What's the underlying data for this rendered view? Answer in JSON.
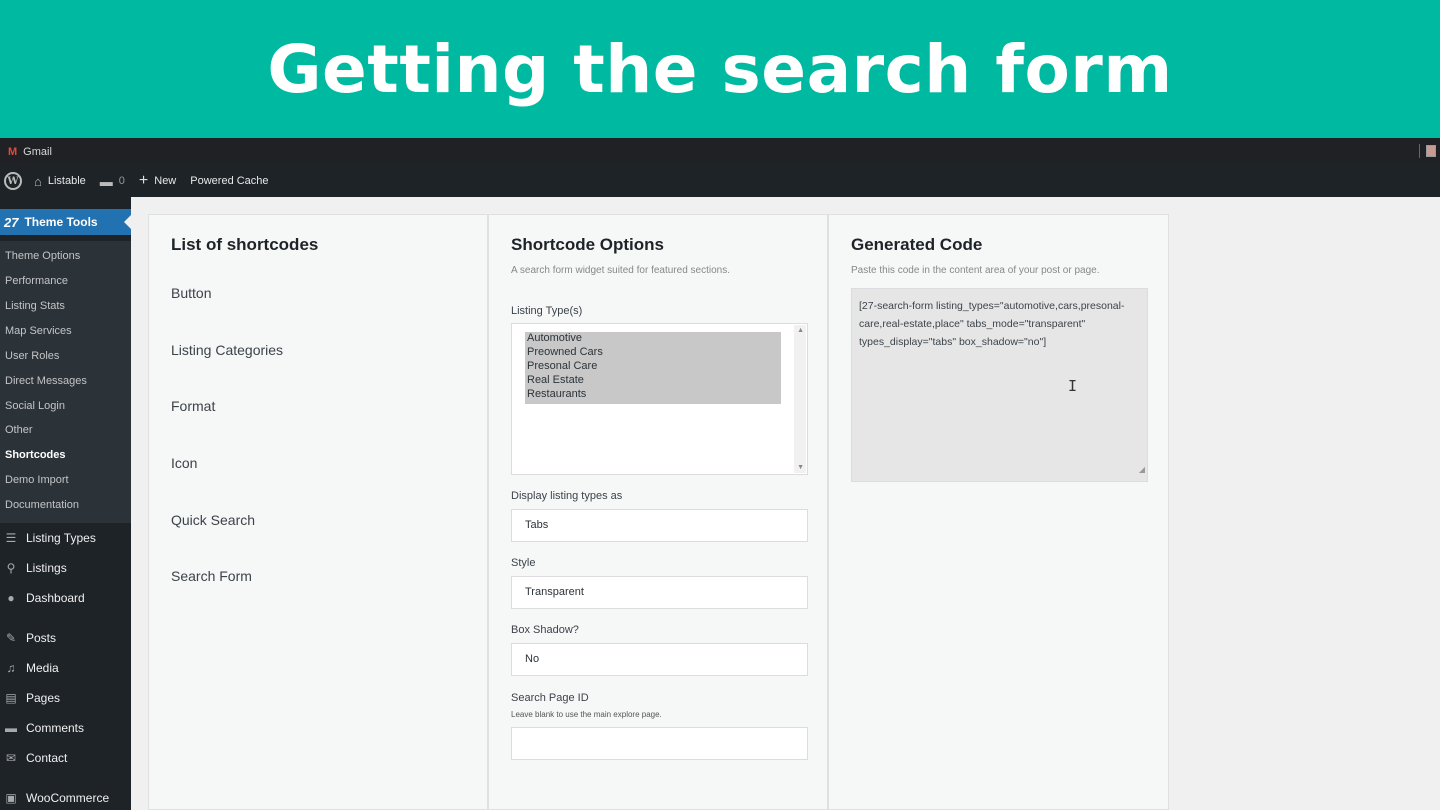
{
  "banner": {
    "title": "Getting the search form"
  },
  "browser_bar": {
    "tab_label": "Gmail",
    "icon": "gmail-icon"
  },
  "admin_bar": {
    "site_name": "Listable",
    "comments_count": "0",
    "new_label": "New",
    "cache_label": "Powered Cache"
  },
  "sidebar": {
    "header": "Theme Tools",
    "submenu": [
      "Theme Options",
      "Performance",
      "Listing Stats",
      "Map Services",
      "User Roles",
      "Direct Messages",
      "Social Login",
      "Other",
      "Shortcodes",
      "Demo Import",
      "Documentation"
    ],
    "active_submenu": "Shortcodes",
    "menu": [
      {
        "label": "Listing Types",
        "icon": "list-icon"
      },
      {
        "label": "Listings",
        "icon": "pin-icon"
      },
      {
        "label": "Dashboard",
        "icon": "palette-icon"
      },
      {
        "label": "Posts",
        "icon": "pushpin-icon"
      },
      {
        "label": "Media",
        "icon": "media-icon"
      },
      {
        "label": "Pages",
        "icon": "pages-icon"
      },
      {
        "label": "Comments",
        "icon": "comment-icon"
      },
      {
        "label": "Contact",
        "icon": "mail-icon"
      },
      {
        "label": "WooCommerce",
        "icon": "woo-icon"
      }
    ]
  },
  "shortcodes_panel": {
    "title": "List of shortcodes",
    "items": [
      "Button",
      "Listing Categories",
      "Format",
      "Icon",
      "Quick Search",
      "Search Form"
    ]
  },
  "options_panel": {
    "title": "Shortcode Options",
    "description": "A search form widget suited for featured sections.",
    "listing_types_label": "Listing Type(s)",
    "listing_types": [
      "Automotive",
      "Preowned Cars",
      "Presonal Care",
      "Real Estate",
      "Restaurants"
    ],
    "display_label": "Display listing types as",
    "display_value": "Tabs",
    "style_label": "Style",
    "style_value": "Transparent",
    "shadow_label": "Box Shadow?",
    "shadow_value": "No",
    "page_id_label": "Search Page ID",
    "page_id_hint": "Leave blank to use the main explore page.",
    "page_id_value": ""
  },
  "code_panel": {
    "title": "Generated Code",
    "description": "Paste this code in the content area of your post or page.",
    "code": "[27-search-form listing_types=\"automotive,cars,presonal-care,real-estate,place\" tabs_mode=\"transparent\" types_display=\"tabs\" box_shadow=\"no\"]"
  },
  "colors": {
    "banner": "#00b9a1",
    "admin_bar": "#1d2327",
    "active_menu": "#2271b1"
  }
}
